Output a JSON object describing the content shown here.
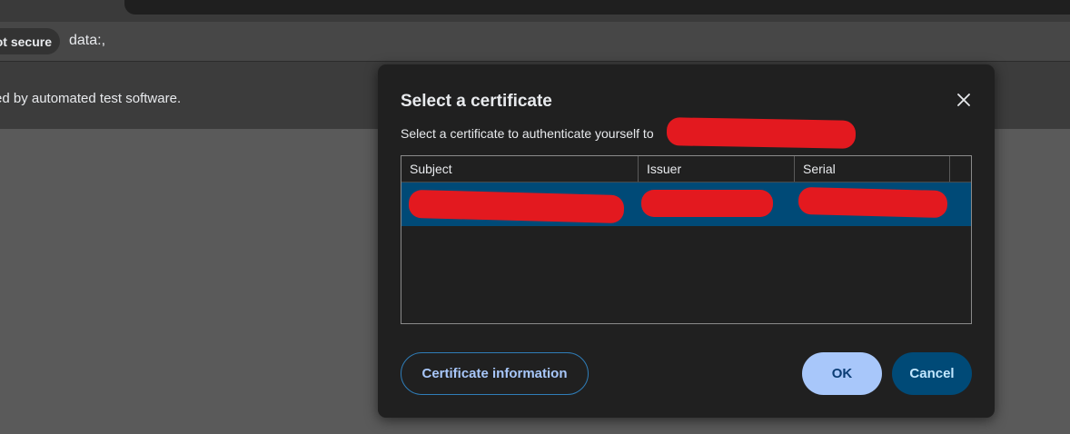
{
  "browser": {
    "security_chip": "ot secure",
    "url": "data:,",
    "infobar_text": "ed by automated test software."
  },
  "dialog": {
    "title": "Select a certificate",
    "description": "Select a certificate to authenticate yourself to",
    "close_icon": "close-icon",
    "table": {
      "columns": [
        "Subject",
        "Issuer",
        "Serial"
      ],
      "selected_row_color": "#004a77"
    },
    "buttons": {
      "info": "Certificate information",
      "ok": "OK",
      "cancel": "Cancel"
    }
  },
  "colors": {
    "redaction": "#e3191f",
    "accent": "#a8c7fa",
    "dialog_bg": "#202020"
  }
}
